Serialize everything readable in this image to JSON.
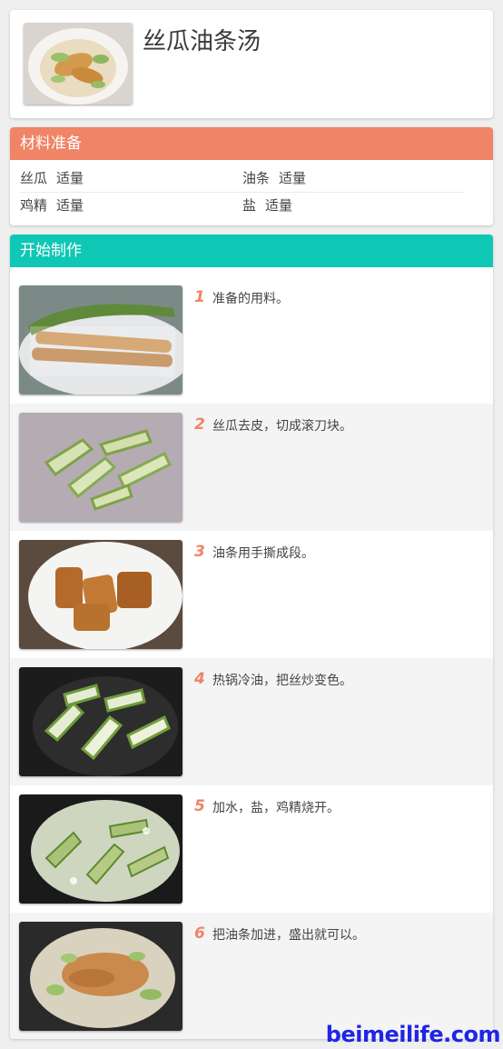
{
  "recipe": {
    "title": "丝瓜油条汤"
  },
  "ingredients": {
    "heading": "材料准备",
    "items": [
      {
        "name": "丝瓜",
        "amount": "适量"
      },
      {
        "name": "油条",
        "amount": "适量"
      },
      {
        "name": "鸡精",
        "amount": "适量"
      },
      {
        "name": "盐",
        "amount": "适量"
      }
    ]
  },
  "steps": {
    "heading": "开始制作",
    "items": [
      {
        "number": "1",
        "text": "准备的用料。"
      },
      {
        "number": "2",
        "text": "丝瓜去皮，切成滚刀块。"
      },
      {
        "number": "3",
        "text": "油条用手撕成段。"
      },
      {
        "number": "4",
        "text": "热锅冷油，把丝炒变色。"
      },
      {
        "number": "5",
        "text": "加水，盐，鸡精烧开。"
      },
      {
        "number": "6",
        "text": "把油条加进，盛出就可以。"
      }
    ]
  },
  "watermark": {
    "text": "beimeilife.com"
  },
  "colors": {
    "ingredients_accent": "#ef8466",
    "steps_accent": "#0ec7b4",
    "watermark": "#1f25e6"
  }
}
